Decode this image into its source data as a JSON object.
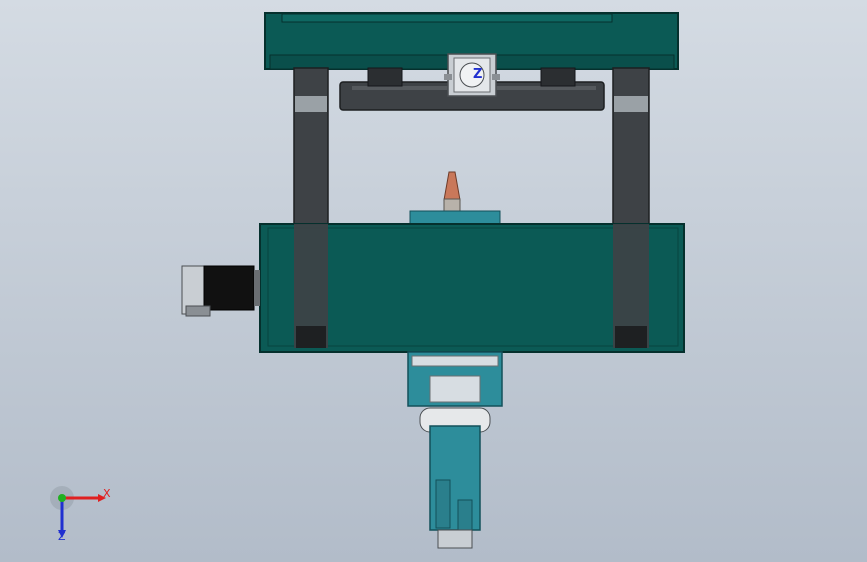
{
  "viewport": {
    "background_top": "#d4dbe3",
    "background_bottom": "#b2bcc9"
  },
  "colors": {
    "frame_teal": "#0b5a55",
    "frame_edge": "#05302d",
    "rail_dark": "#3e4246",
    "rail_band": "#9aa1a6",
    "cyan_part": "#2d8d9b",
    "motor_black": "#111111",
    "copper_nozzle": "#c9785a"
  },
  "triad": {
    "x_label": "X",
    "z_label": "Z",
    "x_color": "#e02020",
    "y_color": "#20b020",
    "z_color": "#2030d0"
  },
  "model_label": "Z"
}
